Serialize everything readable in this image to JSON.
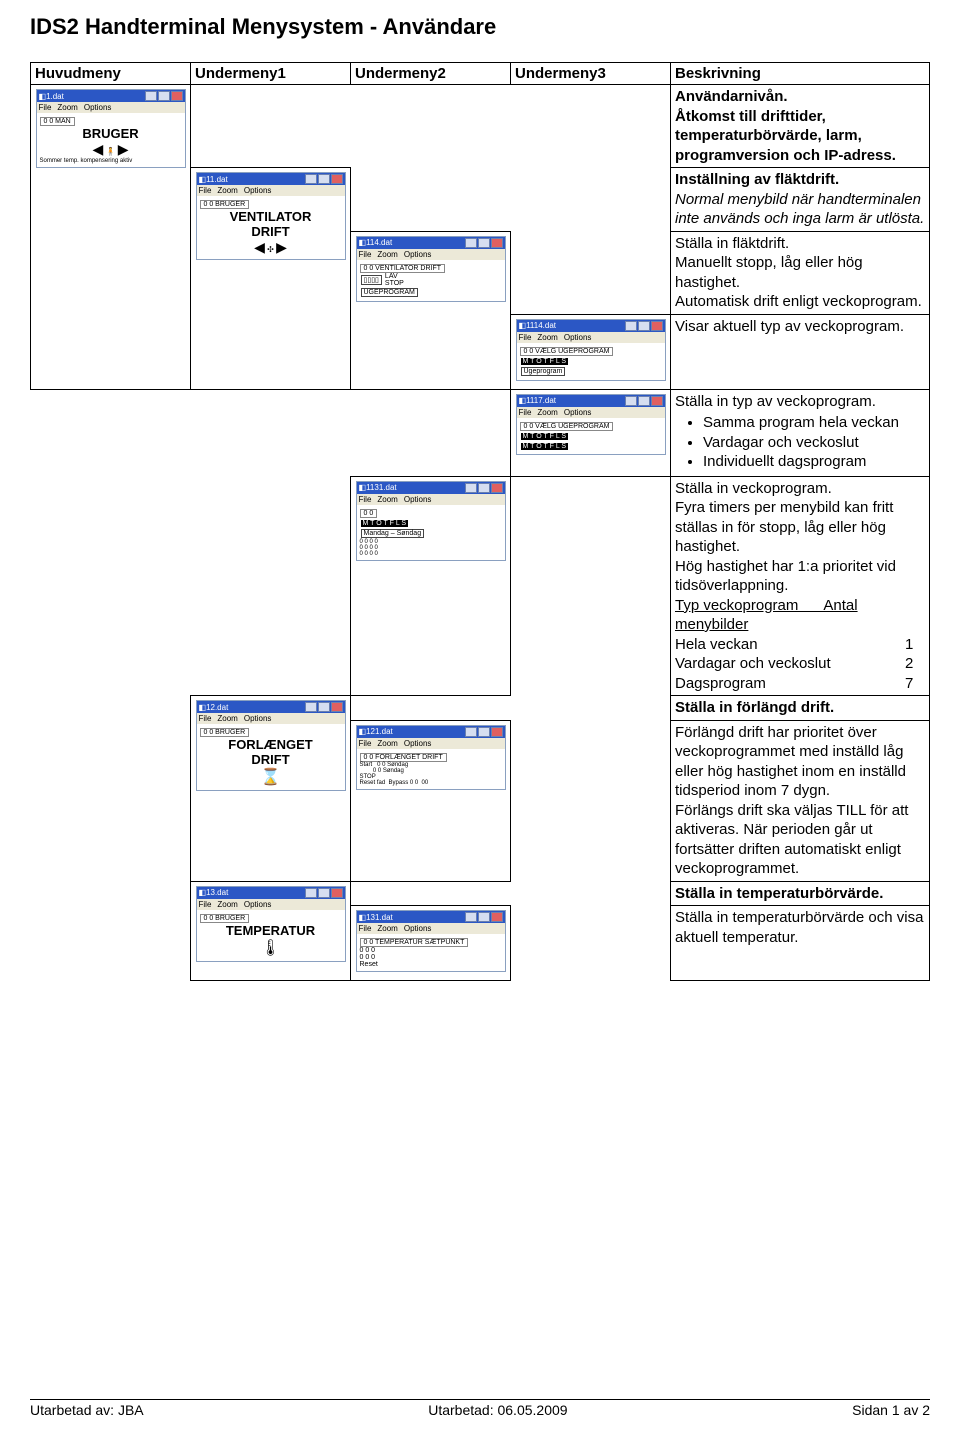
{
  "title": "IDS2 Handterminal Menysystem - Användare",
  "columns": {
    "c1": "Huvudmeny",
    "c2": "Undermeny1",
    "c3": "Undermeny2",
    "c4": "Undermeny3",
    "c5": "Beskrivning"
  },
  "thumbs": {
    "t1": {
      "title": "1.dat",
      "menu": [
        "File",
        "Zoom",
        "Options"
      ],
      "crumbs": "0 0  MAN",
      "big": "BRUGER",
      "extra": "Sommer temp. kompensering aktiv"
    },
    "t11": {
      "title": "11.dat",
      "menu": [
        "File",
        "Zoom",
        "Options"
      ],
      "crumbs": "0 0  BRUGER",
      "big": "VENTILATOR\nDRIFT"
    },
    "t114": {
      "title": "114.dat",
      "menu": [
        "File",
        "Zoom",
        "Options"
      ],
      "crumbs": "0 0  VENTILATOR DRIFT",
      "extra2": "UGEPROGRAM",
      "side": "LAV\nSTOP"
    },
    "t1114": {
      "title": "1114.dat",
      "menu": [
        "File",
        "Zoom",
        "Options"
      ],
      "crumbs": "0 0  VÆLG UGEPROGRAM",
      "days": "M T O T F L S",
      "extra2": "Ugeprogram"
    },
    "t1117": {
      "title": "1117.dat",
      "menu": [
        "File",
        "Zoom",
        "Options"
      ],
      "crumbs": "0 0  VÆLG UGEPROGRAM",
      "days": "M T O T F L S",
      "days2": "M T O T F L S"
    },
    "t1131": {
      "title": "1131.dat",
      "menu": [
        "File",
        "Zoom",
        "Options"
      ],
      "crumbs": "0 0  ",
      "days": "M T O T F L S",
      "line": "Mandag – Søndag",
      "grid": "0 0 0 0\n0 0 0 0\n0 0 0 0"
    },
    "t12": {
      "title": "12.dat",
      "menu": [
        "File",
        "Zoom",
        "Options"
      ],
      "crumbs": "0 0  BRUGER",
      "big": "FORLÆNGET\nDRIFT"
    },
    "t121": {
      "title": "121.dat",
      "menu": [
        "File",
        "Zoom",
        "Options"
      ],
      "crumbs": "0 0  FORLÆNGET DRIFT",
      "line2": "Start   0 0 Søndag\n        0 0 Søndag\nSTOP\nReset fad  Bypass 0 0  00"
    },
    "t13": {
      "title": "13.dat",
      "menu": [
        "File",
        "Zoom",
        "Options"
      ],
      "crumbs": "0 0  BRUGER",
      "big": "TEMPERATUR"
    },
    "t131": {
      "title": "131.dat",
      "menu": [
        "File",
        "Zoom",
        "Options"
      ],
      "crumbs": "0 0  TEMPERATUR SÆTPUNKT",
      "line2": "0 0 0\n0 0 0\nReset"
    }
  },
  "rows": [
    {
      "id": "r1",
      "col": 1,
      "thumb": "t1",
      "desc": "<b>Användarnivån.</b><br>Åtmkost till drifttider, temperaturbörvärde, larm, programversion och IP-adress.",
      "descFix": "<b>Användarnivån.</b><br>Åtkomst till drifttider, temperaturbörvärde, larm, programversion och IP-adress."
    },
    {
      "id": "r2",
      "col": 2,
      "thumb": "t11",
      "desc": "<b>Inställning av fläktdrift.</b><br><i>Normal menybild när handterminalen inte används och inga larm är utlösta.</i>"
    },
    {
      "id": "r3",
      "col": 3,
      "thumb": "t114",
      "desc": "Ställa in fläktdrift.<br>Manuellt stopp, låg eller hög hastighet.<br>Automatisk drift enligt veckoprogram."
    },
    {
      "id": "r4",
      "col": 4,
      "thumb": "t1114",
      "desc": "Visar aktuell typ av veckoprogram."
    },
    {
      "id": "r5",
      "col": 4,
      "thumb": "t1117",
      "desc": "Ställa in typ av veckoprogram.",
      "bullets": [
        "Samma program hela veckan",
        "Vardagar och veckoslut",
        "Individuellt dagsprogram"
      ]
    },
    {
      "id": "r6",
      "col": 3,
      "thumb": "t1131",
      "desc": "Ställa in veckoprogram.<br>Fyra timers per menybild kan fritt ställas in för stopp, låg eller hög hastighet.<br>Hög hastighet har 1:a prioritet vid tidsöverlappning.",
      "post": "<br><span class='ul'>Typ veckoprogram&nbsp;&nbsp;&nbsp;&nbsp;&nbsp;&nbsp;Antal menybilder</span><br><span class='tabstop'>Hela veckan</span>1<br><span class='tabstop'>Vardagar och veckoslut</span>2<br><span class='tabstop'>Dagsprogram</span>7"
    },
    {
      "id": "r7",
      "col": 2,
      "thumb": "t12",
      "desc": "<b>Ställa in förlängd drift.</b>"
    },
    {
      "id": "r8",
      "col": 3,
      "thumb": "t121",
      "desc": "Förlängd drift har prioritet över veckoprogrammet med inställd låg eller hög hastighet inom en inställd tidsperiod inom 7 dygn.<br>Förlängs drift ska väljas TILL för att aktiveras. När perioden går ut fortsätter driften automatiskt enligt veckoprogrammet."
    },
    {
      "id": "r9",
      "col": 2,
      "thumb": "t13",
      "desc": "<b>Ställa in temperaturbörvärde.</b>"
    },
    {
      "id": "r10",
      "col": 3,
      "thumb": "t131",
      "desc": "Ställa in temperaturbörvärde och visa aktuell temperatur."
    }
  ],
  "footer": {
    "left": "Utarbetad av: JBA",
    "mid": "Utarbetad: 06.05.2009",
    "right": "Sidan 1 av 2"
  }
}
